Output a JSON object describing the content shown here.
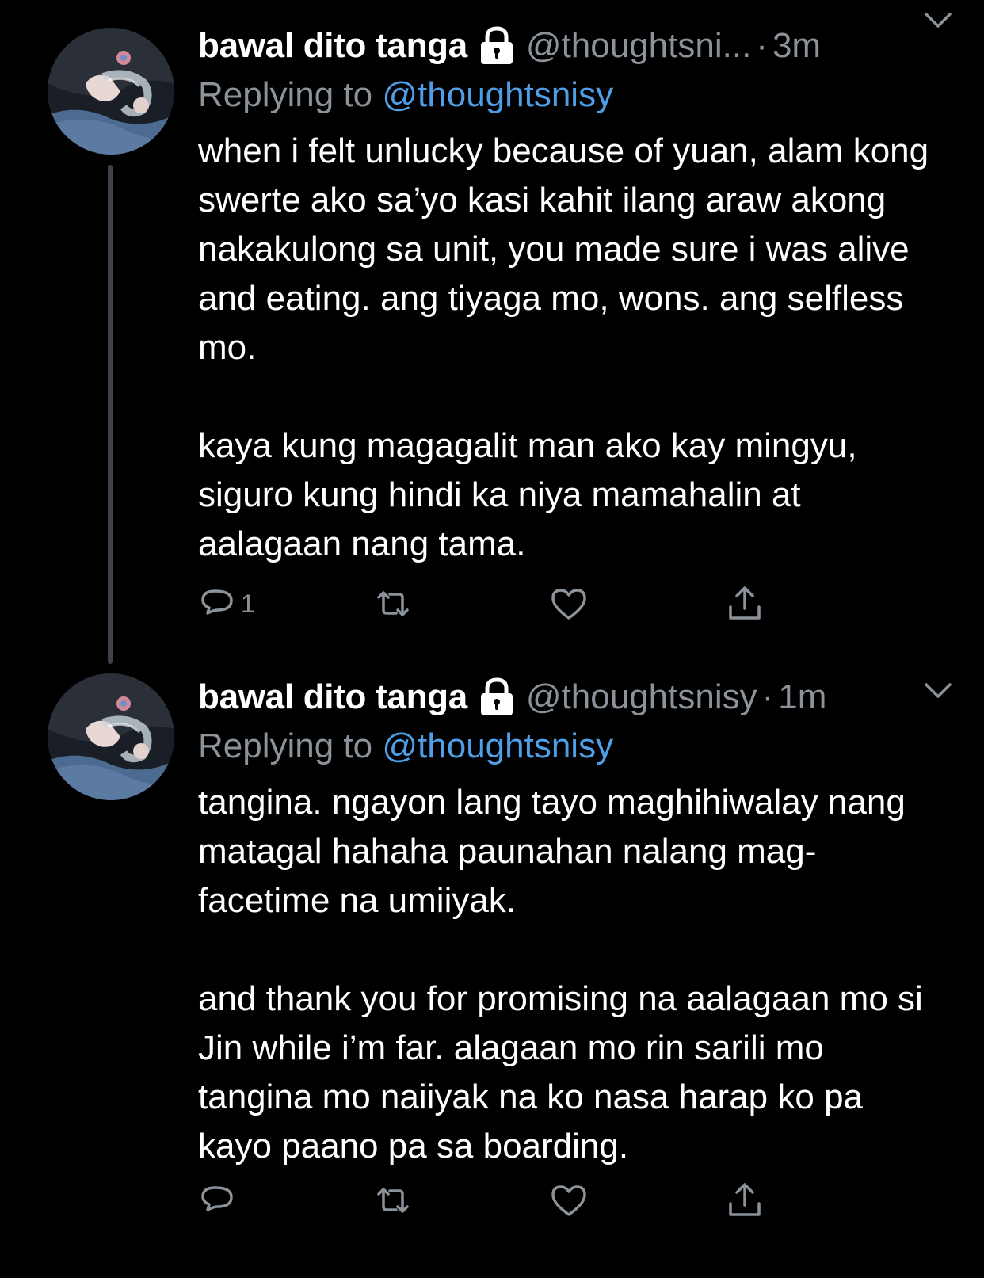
{
  "tweets": [
    {
      "display_name": "bawal dito tanga",
      "handle": "@thoughtsni...",
      "separator": "·",
      "time": "3m",
      "replying_prefix": "Replying to ",
      "replying_to": "@thoughtsnisy",
      "paragraphs": [
        "when i felt unlucky because of yuan, alam kong swerte ako sa’yo kasi kahit ilang araw akong nakakulong sa unit, you made sure i was alive and eating. ang tiyaga mo, wons. ang selfless mo.",
        "kaya kung magagalit man ako kay mingyu, siguro kung hindi ka niya mamahalin at aalagaan nang tama."
      ],
      "reply_count": "1",
      "has_thread_line": true
    },
    {
      "display_name": "bawal dito tanga",
      "handle": "@thoughtsnisy",
      "separator": "·",
      "time": "1m",
      "replying_prefix": "Replying to ",
      "replying_to": "@thoughtsnisy",
      "paragraphs": [
        "tangina. ngayon lang tayo maghihiwalay nang matagal hahaha paunahan nalang mag-facetime na umiiyak.",
        "and thank you for promising na aalagaan mo si Jin while i’m far. alagaan mo rin sarili mo tangina mo naiiyak na ko nasa harap ko pa kayo paano pa sa boarding."
      ],
      "reply_count": "",
      "has_thread_line": false
    }
  ],
  "icons": {
    "lock": "lock-icon",
    "chevron": "chevron-down-icon",
    "reply": "reply-icon",
    "retweet": "retweet-icon",
    "like": "heart-icon",
    "share": "share-icon"
  },
  "colors": {
    "background": "#000000",
    "text_primary": "#ffffff",
    "text_secondary": "#8b9299",
    "mention": "#4f9fe8",
    "thread_line": "#3d4248"
  }
}
